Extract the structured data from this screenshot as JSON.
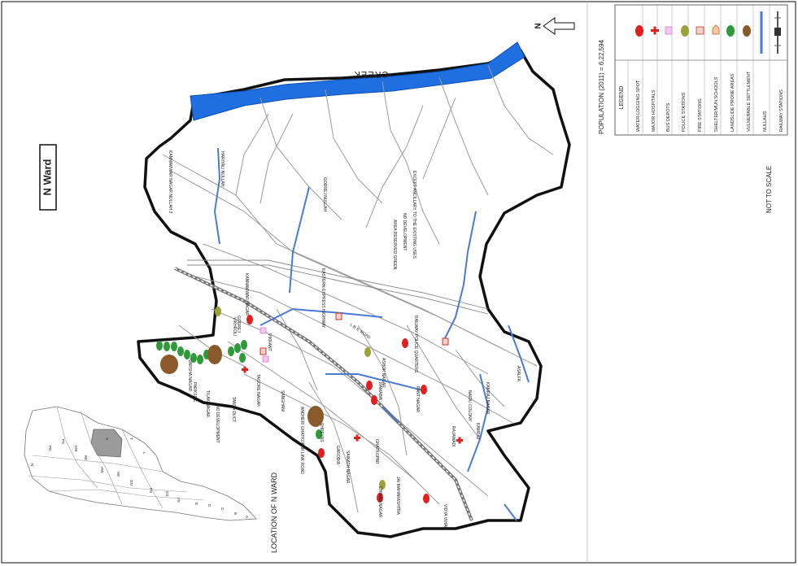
{
  "ward_title": "N Ward",
  "creek_label": "CREEK",
  "north_label": "N",
  "population": "POPULATION (2011) = 6,22,594",
  "not_to_scale": "NOT TO SCALE",
  "location_caption": "LOCATION OF N WARD",
  "legend": {
    "title": "LEGEND",
    "items": [
      {
        "label": "WATER-LOGGING SPOT",
        "color": "#e02020",
        "icon": "red-dot-icon"
      },
      {
        "label": "MAJOR HOSPITALS",
        "color": "#e02020",
        "icon": "red-cross-icon"
      },
      {
        "label": "BUS DEPOTS",
        "color": "#d67ad0",
        "icon": "bus-depot-icon"
      },
      {
        "label": "POLICE STATIONS",
        "color": "#9aa33a",
        "icon": "olive-dot-icon"
      },
      {
        "label": "FIRE STATIONS",
        "color": "#c0392b",
        "icon": "fire-station-icon"
      },
      {
        "label": "SHELTER/MUN.SCHOOLS",
        "color": "#c2652a",
        "icon": "shelter-icon"
      },
      {
        "label": "LANDSLIDE PRONE AREAS",
        "color": "#2e9a3a",
        "icon": "green-dot-icon"
      },
      {
        "label": "VULNERABLE SETTLEMENT",
        "color": "#8a5a2b",
        "icon": "brown-dot-icon"
      },
      {
        "label": "NULLAHS",
        "color": "#4a7bd0",
        "icon": "blue-line-icon"
      },
      {
        "label": "RAILWAY STATIONS",
        "color": "#555555",
        "icon": "railway-icon"
      }
    ]
  },
  "map_labels": {
    "eastern_highway": "EASTERN EXPRESS HIGHWAY",
    "lbs_road": "L.B.S. ROAD",
    "ghatkopar": "GHATKOPAR",
    "vikhroli": "VIKHROLI",
    "pant_nagar": "PANT NAGAR",
    "rajawadi": "RAJAWADI",
    "vidya_vihar": "VIDYA VIHAR",
    "tilak_nagar": "TILAK NAGAR",
    "ramabai": "RAMABAI",
    "jai_maharashtra": "JAI MAHARASHTRA",
    "chirag_nagar": "CHIRAG NAGAR",
    "kamraj_nagar": "KAMRAJ NAGAR",
    "godrej": "GODREJ",
    "vikrant": "VIKRANT",
    "naidu_colony": "NAIDU COLONY",
    "garodia": "GARODIA",
    "shreyas": "SHREYAS",
    "andheri_ghatkopar_link": "ANDHERI GHATKOPAR LINK ROAD",
    "sainath_nagar": "SAINATH NAGAR",
    "sanghani": "SANGHANI",
    "ashok_nagar": "ASHOK NAGAR",
    "parksite": "PARKSITE",
    "varsha_nagar": "VARSHA NAGAR",
    "asalfa": "ASALFA",
    "no_development": "NO DEVELOPMENT",
    "tansa_duct": "TANSA DUCT",
    "area_reserved": "AREA RESERVED GREEN",
    "nd_development": "ND DEVELOPMENT",
    "except_ancillary": "EXCEPT ANCILLARY TO THE EXISTING USES",
    "godrej_nullah": "GODREJ NULLAH",
    "kannamwar_nallah": "KANNAMWAR NAGAR NULLAH 2",
    "hariyali_nullah": "HARIYALI NULLAH",
    "tagore_nagar": "TAGORE NAGAR",
    "kannamwar_nagar": "KANNAMWAR NAGAR",
    "kamraj": "KAMRAJ",
    "railway_police": "RAILWAY POLICE QUARTERS"
  },
  "inset_labels": [
    "N",
    "S",
    "T",
    "L",
    "ME",
    "MW",
    "RN",
    "RS",
    "PN",
    "PS",
    "KW",
    "KE",
    "HW",
    "HE",
    "GN",
    "FN",
    "GS",
    "FS",
    "E",
    "D",
    "C",
    "B",
    "A"
  ]
}
